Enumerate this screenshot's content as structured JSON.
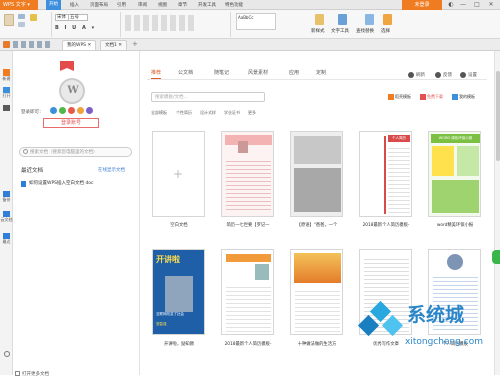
{
  "app": {
    "menu": "WPS 文字",
    "login": "未登录"
  },
  "menutabs": [
    "开始",
    "插入",
    "页面布局",
    "引用",
    "审阅",
    "视图",
    "章节",
    "开发工具",
    "特色功能"
  ],
  "ribbon": {
    "font": "宋体（正文）",
    "size": "五号",
    "btn_newstyle": "新样式",
    "btn_texttool": "文字工具",
    "btn_find": "查找替换",
    "btn_select": "选择"
  },
  "doctabs": [
    "我的WPS",
    "文档1"
  ],
  "leftnav": [
    "新建",
    "打开",
    "在线模板",
    "",
    "备份",
    "云文档",
    "最近",
    "设置"
  ],
  "left": {
    "login_hint": "登录即可：",
    "register": "登录账号",
    "search_placeholder": "搜索文档（搜索您电脑里的文档）",
    "recent": "最近文档",
    "recent_link": "在线显示文档",
    "recent_file": "如何设置WPS插入空白文档 doc",
    "open_more": "打开更多文档"
  },
  "content_tabs": [
    "推荐",
    "公文档",
    "随笔记",
    "风景素材",
    "应用",
    "定制"
  ],
  "tools": [
    "刷新",
    "反馈",
    "设置"
  ],
  "search_placeholder": "搜索模板/文档...",
  "categories": [
    "全部模板",
    "个性简历",
    "设计式样",
    "学业证书",
    "更多"
  ],
  "buttons": [
    "稻壳模板",
    "免费下载",
    "我的模板"
  ],
  "tiles": [
    {
      "label": "空白文档"
    },
    {
      "label": "简历一七世要【罗记一"
    },
    {
      "label": "【原语】\"爸爸，一个"
    },
    {
      "label": "2018最新个人简历模板-"
    },
    {
      "label": "word精美环保小报"
    },
    {
      "label": "开讲啦，励知教"
    },
    {
      "label": "2018最新个人简历模板-"
    },
    {
      "label": "十种做法做的生活方"
    },
    {
      "label": "优秀写作文章"
    },
    {
      "label": "个人简历模板"
    }
  ],
  "tile_texts": {
    "t3": "个人简历",
    "t4": "WORD 绿色环保小报",
    "t5": "开讲啦",
    "t5b": "互联网改变了社会",
    "t5c": "邹智强"
  },
  "watermark": {
    "cn": "系统城",
    "en": "xitongcheng.com"
  },
  "colors": {
    "accent": "#f07c22",
    "blue": "#3c8fdc",
    "orange": "#e05c2a"
  }
}
